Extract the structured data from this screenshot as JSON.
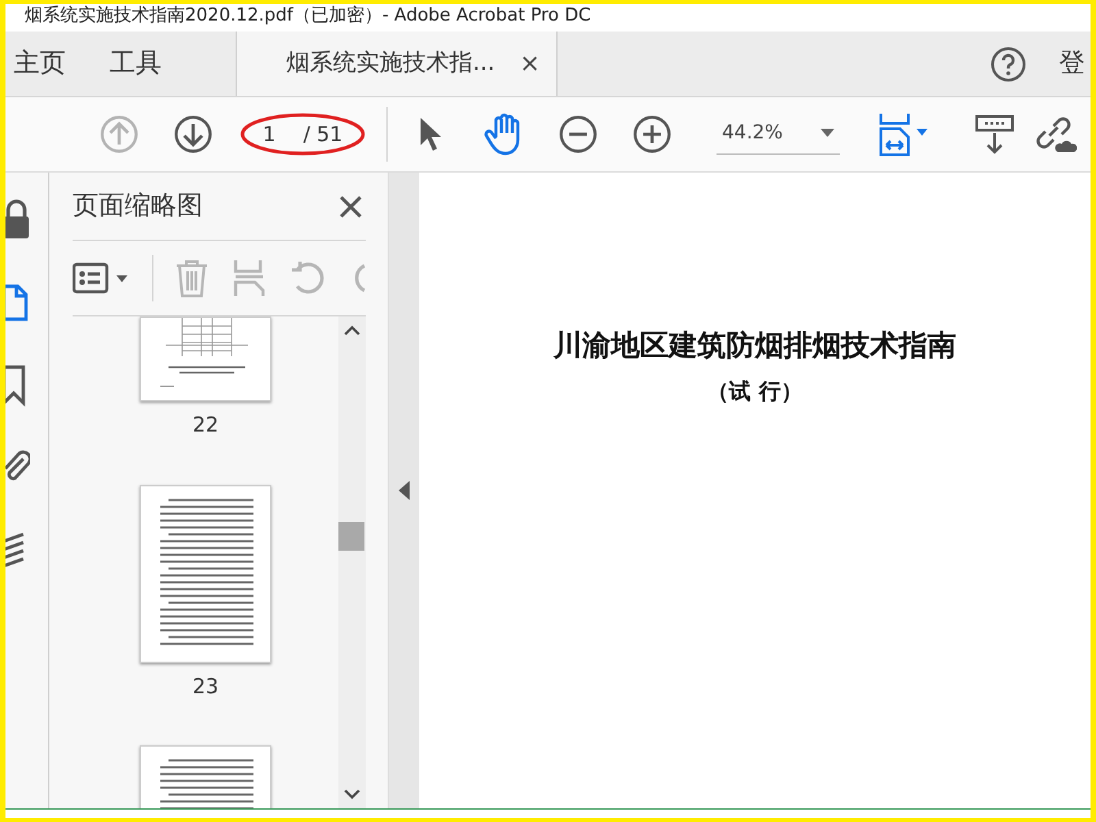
{
  "window": {
    "title": "烟系统实施技术指南2020.12.pdf（已加密）- Adobe Acrobat Pro DC"
  },
  "tabs": [
    {
      "label": "主页",
      "selected": false,
      "closable": false
    },
    {
      "label": "工具",
      "selected": false,
      "closable": false
    },
    {
      "label": "烟系统实施技术指...",
      "selected": true,
      "closable": true
    }
  ],
  "tab_close": "×",
  "account_label": "登",
  "toolbar": {
    "nav": [
      {
        "kind": "up",
        "disabled": true
      },
      {
        "kind": "down",
        "disabled": false
      }
    ],
    "page_current": "1",
    "page_total": "/ 51",
    "annotation": {
      "kind": "ellipse",
      "color": "#e02020"
    },
    "tools": [
      {
        "kind": "select",
        "selected": false
      },
      {
        "kind": "hand",
        "selected": true
      },
      {
        "kind": "zoom-out",
        "selected": false
      },
      {
        "kind": "zoom-in",
        "selected": false
      }
    ],
    "zoom": "44.2%"
  },
  "sidebar": {
    "rail": [
      {
        "kind": "lock",
        "selected": false
      },
      {
        "kind": "pages",
        "selected": true
      },
      {
        "kind": "bookmark",
        "selected": false
      },
      {
        "kind": "attachment",
        "selected": false
      },
      {
        "kind": "layers",
        "selected": false
      }
    ],
    "panel_title": "页面缩略图",
    "thumbnails": [
      {
        "kind": "figure",
        "label": "22"
      },
      {
        "kind": "text",
        "label": "23"
      },
      {
        "kind": "text"
      }
    ]
  },
  "document": {
    "title": "川渝地区建筑防烟排烟技术指南",
    "subtitle": "（试 行）"
  }
}
